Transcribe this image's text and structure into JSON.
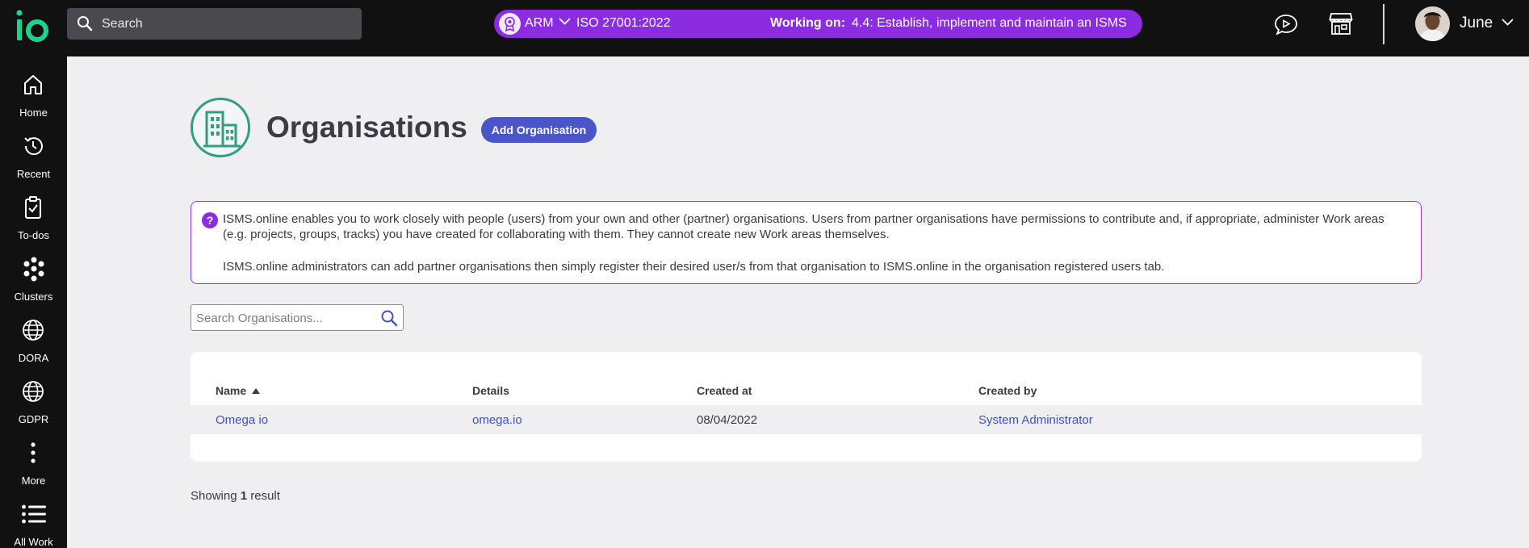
{
  "topbar": {
    "logo_text": "io",
    "search_label": "Search",
    "framework": {
      "name": "ARM",
      "standard": "ISO 27001:2022",
      "working_on_label": "Working on:",
      "working_on_task": "4.4: Establish, implement and maintain an ISMS"
    },
    "user_name": "June"
  },
  "sidebar": {
    "items": [
      {
        "label": "Home",
        "icon": "home-icon"
      },
      {
        "label": "Recent",
        "icon": "history-icon"
      },
      {
        "label": "To-dos",
        "icon": "clipboard-check-icon"
      },
      {
        "label": "Clusters",
        "icon": "clusters-icon"
      },
      {
        "label": "DORA",
        "icon": "globe-icon"
      },
      {
        "label": "GDPR",
        "icon": "globe-icon"
      },
      {
        "label": "More",
        "icon": "more-vertical-icon"
      },
      {
        "label": "All Work",
        "icon": "list-icon"
      }
    ]
  },
  "page": {
    "title": "Organisations",
    "add_button": "Add Organisation",
    "info": {
      "paragraph_1": "ISMS.online enables you to work closely with people (users) from your own and other (partner) organisations. Users from partner organisations have permissions to contribute and, if appropriate, administer Work areas (e.g. projects, groups, tracks) you have created for collaborating with them. They cannot create new Work areas themselves.",
      "paragraph_2": "ISMS.online administrators can add partner organisations then simply register their desired user/s from that organisation to ISMS.online in the organisation registered users tab."
    },
    "search_placeholder": "Search Organisations...",
    "table": {
      "columns": [
        "Name",
        "Details",
        "Created at",
        "Created by"
      ],
      "rows": [
        {
          "name": "Omega io",
          "details": "omega.io",
          "created_at": "08/04/2022",
          "created_by": "System Administrator"
        }
      ]
    },
    "result": {
      "prefix": "Showing",
      "count": "1",
      "suffix": "result"
    }
  },
  "colors": {
    "accent_purple": "#8b2be2",
    "button_blue": "#4a55c8",
    "link_blue": "#3f53c4",
    "org_icon_green": "#2f9e83",
    "logo_green": "#1fd18f"
  }
}
